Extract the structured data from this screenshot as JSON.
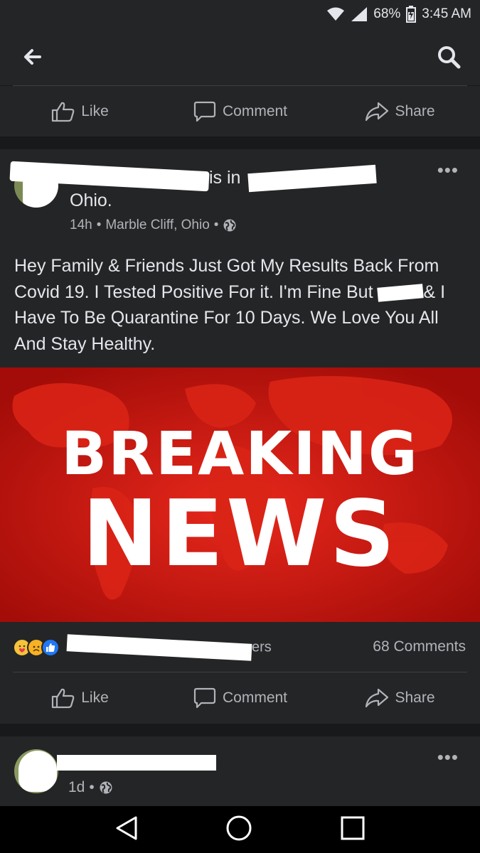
{
  "status_bar": {
    "battery": "68%",
    "time": "3:45 AM",
    "icons": [
      "wifi-icon",
      "signal-icon",
      "battery-icon"
    ]
  },
  "top_nav": {
    "icons": [
      "back-arrow-icon",
      "search-icon"
    ]
  },
  "action_bar": {
    "like_label": "Like",
    "comment_label": "Comment",
    "share_label": "Share"
  },
  "post": {
    "author_suffix": "is in",
    "location_line2": "Ohio.",
    "time": "14h",
    "place": "Marble Cliff, Ohio",
    "privacy_icon": "globe-icon",
    "text_part1": "Hey Family & Friends Just Got My Results Back From Covid 19. I Tested Positive For it. I'm Fine But",
    "text_part2": "& I Have To Be Quarantine For 10 Days. We Love You All And Stay Healthy.",
    "image": {
      "line1": "BREAKING",
      "line2": "NEWS"
    },
    "reactions": [
      "love-reaction",
      "sad-reaction",
      "like-reaction"
    ],
    "reaction_names_tail": "ers",
    "comments": "68 Comments"
  },
  "post2": {
    "time": "1d",
    "privacy_icon": "globe-icon"
  },
  "android_nav": {
    "icons": [
      "back-triangle-icon",
      "home-circle-icon",
      "recents-square-icon"
    ]
  },
  "colors": {
    "background": "#18191a",
    "card": "#242526",
    "text": "#e4e6eb",
    "muted": "#b0b3b8",
    "news_red": "#c8140f",
    "like_blue": "#2078f4"
  }
}
